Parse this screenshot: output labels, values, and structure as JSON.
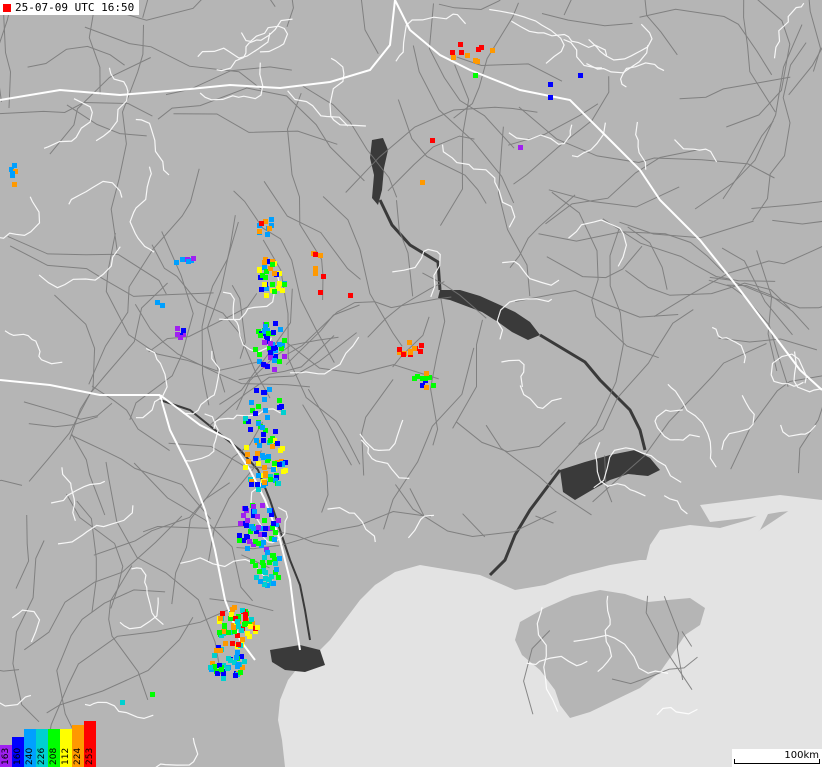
{
  "header": {
    "timestamp": "25-07-09 UTC 16:50",
    "flag_color": "#ff0000"
  },
  "legend": {
    "items": [
      {
        "label": "163",
        "color": "#a020f0"
      },
      {
        "label": "160",
        "color": "#0000ff"
      },
      {
        "label": "240",
        "color": "#00a0ff"
      },
      {
        "label": "226",
        "color": "#00d0d0"
      },
      {
        "label": "208",
        "color": "#00ff00"
      },
      {
        "label": "112",
        "color": "#ffff00"
      },
      {
        "label": "224",
        "color": "#ff9900"
      },
      {
        "label": "253",
        "color": "#ff0000"
      }
    ]
  },
  "scale": {
    "label": "100km"
  },
  "colors": {
    "land": "#b5b5b5",
    "sea": "#e3e3e3",
    "water": "#3a3a3a",
    "roads": "#777777",
    "borders": "#ffffff"
  }
}
